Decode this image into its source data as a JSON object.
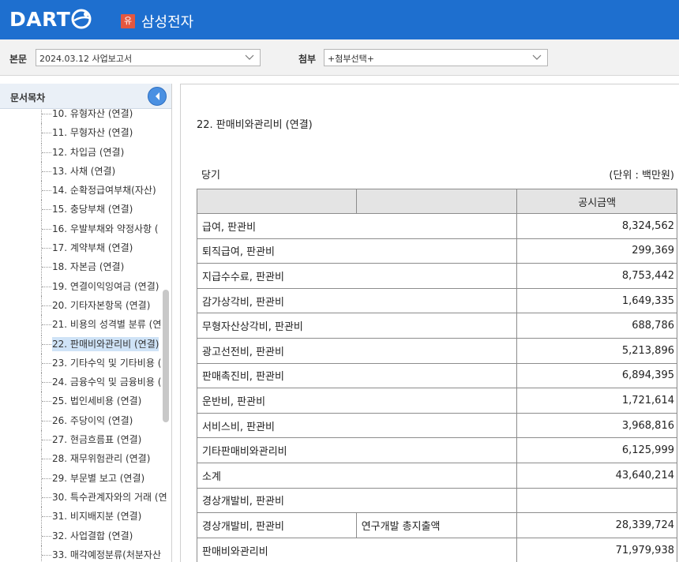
{
  "header": {
    "logo_text": "DART",
    "company_badge": "유",
    "company_name": "삼성전자",
    "bar_color": "#1e6fcf"
  },
  "selectors": {
    "main_label": "본문",
    "main_value": "2024.03.12  사업보고서",
    "attach_label": "첨부",
    "attach_value": "+첨부선택+"
  },
  "sidebar": {
    "title": "문서목차",
    "items": [
      {
        "label": "10. 유형자산 (연결)"
      },
      {
        "label": "11. 무형자산 (연결)"
      },
      {
        "label": "12. 차입금 (연결)"
      },
      {
        "label": "13. 사채 (연결)"
      },
      {
        "label": "14. 순확정급여부채(자산)"
      },
      {
        "label": "15. 충당부채 (연결)"
      },
      {
        "label": "16. 우발부채와 약정사항 ("
      },
      {
        "label": "17. 계약부채 (연결)"
      },
      {
        "label": "18. 자본금 (연결)"
      },
      {
        "label": "19. 연결이익잉여금 (연결)"
      },
      {
        "label": "20. 기타자본항목 (연결)"
      },
      {
        "label": "21. 비용의 성격별 분류 (연"
      },
      {
        "label": "22. 판매비와관리비 (연결)"
      },
      {
        "label": "23. 기타수익 및 기타비용 ("
      },
      {
        "label": "24. 금융수익 및 금융비용 ("
      },
      {
        "label": "25. 법인세비용 (연결)"
      },
      {
        "label": "26. 주당이익 (연결)"
      },
      {
        "label": "27. 현금흐름표 (연결)"
      },
      {
        "label": "28. 재무위험관리 (연결)"
      },
      {
        "label": "29. 부문별 보고 (연결)"
      },
      {
        "label": "30. 특수관계자와의 거래 (연"
      },
      {
        "label": "31. 비지배지분 (연결)"
      },
      {
        "label": "32. 사업결합 (연결)"
      },
      {
        "label": "33. 매각예정분류(처분자산"
      }
    ],
    "selected_index": 12
  },
  "main": {
    "section_title": "22. 판매비와관리비 (연결)",
    "period": "당기",
    "unit": "(단위 : 백만원)",
    "table": {
      "amount_header": "공시금액",
      "rows": [
        {
          "name": "급여, 판관비",
          "desc": "",
          "value": "8,324,562"
        },
        {
          "name": "퇴직급여, 판관비",
          "desc": "",
          "value": "299,369"
        },
        {
          "name": "지급수수료, 판관비",
          "desc": "",
          "value": "8,753,442"
        },
        {
          "name": "감가상각비, 판관비",
          "desc": "",
          "value": "1,649,335"
        },
        {
          "name": "무형자산상각비, 판관비",
          "desc": "",
          "value": "688,786"
        },
        {
          "name": "광고선전비, 판관비",
          "desc": "",
          "value": "5,213,896"
        },
        {
          "name": "판매촉진비, 판관비",
          "desc": "",
          "value": "6,894,395"
        },
        {
          "name": "운반비, 판관비",
          "desc": "",
          "value": "1,721,614"
        },
        {
          "name": "서비스비, 판관비",
          "desc": "",
          "value": "3,968,816"
        },
        {
          "name": "기타판매비와관리비",
          "desc": "",
          "value": "6,125,999"
        },
        {
          "name": "소계",
          "desc": "",
          "value": "43,640,214"
        },
        {
          "name": "경상개발비, 판관비",
          "desc": "",
          "value": ""
        },
        {
          "name": "경상개발비, 판관비",
          "desc": "연구개발 총지출액",
          "value": "28,339,724"
        },
        {
          "name": "판매비와관리비",
          "desc": "",
          "value": "71,979,938"
        }
      ]
    }
  }
}
